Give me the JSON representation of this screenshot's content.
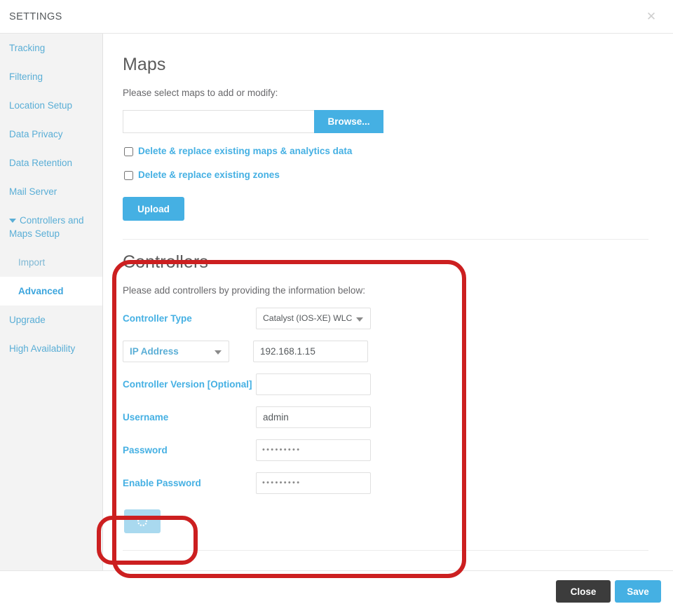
{
  "header": {
    "title": "SETTINGS",
    "close_icon": "close-icon",
    "close_glyph": "✕"
  },
  "sidebar": {
    "items": [
      {
        "label": "Tracking",
        "type": "item",
        "active": false
      },
      {
        "label": "Filtering",
        "type": "item",
        "active": false
      },
      {
        "label": "Location Setup",
        "type": "item",
        "active": false
      },
      {
        "label": "Data Privacy",
        "type": "item",
        "active": false
      },
      {
        "label": "Data Retention",
        "type": "item",
        "active": false
      },
      {
        "label": "Mail Server",
        "type": "item",
        "active": false
      },
      {
        "label": "Controllers and Maps Setup",
        "type": "group",
        "active": false,
        "icon": "chevron-down-icon"
      },
      {
        "label": "Import",
        "type": "sub",
        "active": false
      },
      {
        "label": "Advanced",
        "type": "sub",
        "active": true
      },
      {
        "label": "Upgrade",
        "type": "item",
        "active": false
      },
      {
        "label": "High Availability",
        "type": "item",
        "active": false
      }
    ]
  },
  "maps": {
    "title": "Maps",
    "instruction": "Please select maps to add or modify:",
    "file_value": "",
    "file_placeholder": "",
    "browse_label": "Browse...",
    "checkbox_maps_label": "Delete & replace existing maps & analytics data",
    "checkbox_zones_label": "Delete & replace existing zones",
    "upload_label": "Upload"
  },
  "controllers": {
    "title": "Controllers",
    "instruction": "Please add controllers by providing the information below:",
    "controller_type_label": "Controller Type",
    "controller_type_value": "Catalyst (IOS-XE) WLC",
    "address_kind_value": "IP Address",
    "address_value": "192.168.1.15",
    "version_label": "Controller Version [Optional]",
    "version_value": "",
    "username_label": "Username",
    "username_value": "admin",
    "password_label": "Password",
    "password_value": "•••••••••",
    "enable_password_label": "Enable Password",
    "enable_password_value": "•••••••••",
    "submit_state": "loading",
    "submit_icon": "loading-spinner-icon"
  },
  "footer": {
    "close_label": "Close",
    "save_label": "Save"
  },
  "colors": {
    "accent_blue": "#45b0e3",
    "link_blue": "#5aaed6",
    "dark_button": "#3c3c3c",
    "annotation_red": "#cc1f20",
    "spinner_button": "#a9d9ef",
    "sidebar_bg": "#f3f3f3"
  }
}
